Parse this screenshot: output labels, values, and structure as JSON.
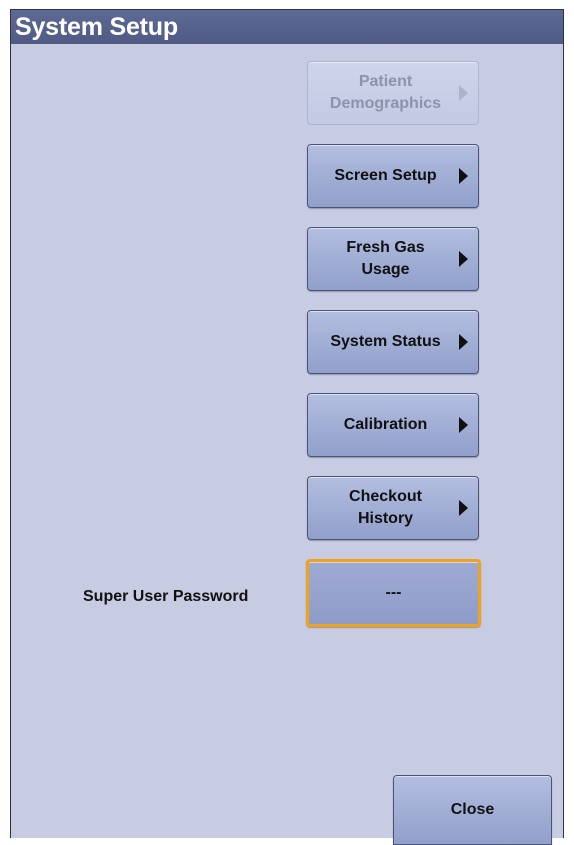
{
  "window": {
    "title": "System Setup"
  },
  "menu": [
    {
      "label": "Patient\nDemographics",
      "enabled": false,
      "has_arrow": true
    },
    {
      "label": "Screen Setup",
      "enabled": true,
      "has_arrow": true
    },
    {
      "label": "Fresh Gas\nUsage",
      "enabled": true,
      "has_arrow": true
    },
    {
      "label": "System Status",
      "enabled": true,
      "has_arrow": true
    },
    {
      "label": "Calibration",
      "enabled": true,
      "has_arrow": true
    },
    {
      "label": "Checkout\nHistory",
      "enabled": true,
      "has_arrow": true
    }
  ],
  "password": {
    "label": "Super User Password",
    "value": "---",
    "focused": true
  },
  "footer": {
    "close_label": "Close"
  },
  "colors": {
    "panel_bg": "#c7cce2",
    "titlebar": "#55618b",
    "focus_border": "#f0a31a"
  },
  "icons": {
    "submenu": "right-triangle-arrow-icon"
  }
}
